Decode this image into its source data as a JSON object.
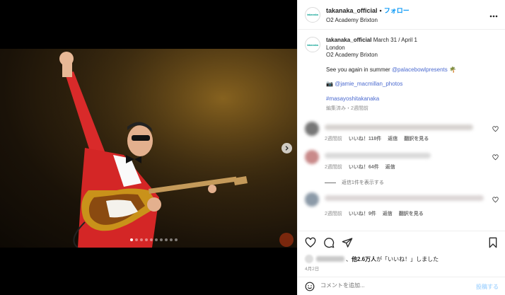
{
  "header": {
    "avatar_text": "takanaka",
    "username": "takanaka_official",
    "separator": "•",
    "follow_label": "フォロー",
    "location": "O2 Academy Brixton"
  },
  "caption": {
    "username": "takanaka_official",
    "line1": "March 31 / April 1",
    "line2": "London",
    "line3": "O2 Academy Brixton",
    "line4_text": "See you again in summer ",
    "line4_mention": "@palacebowlpresents",
    "line4_emoji": "🌴",
    "credit_emoji": "📷",
    "credit_mention": "@jamie_macmillan_photos",
    "hashtag": "#masayoshitakanaka",
    "meta": "編集済み・2週間前"
  },
  "comments": [
    {
      "time": "2週間前",
      "likes": "いいね！118件",
      "reply": "返信",
      "translate": "翻訳を見る"
    },
    {
      "time": "2週間前",
      "likes": "いいね！64件",
      "reply": "返信"
    },
    {
      "time": "2週間前",
      "likes": "いいね！9件",
      "reply": "返信",
      "translate": "翻訳を見る"
    }
  ],
  "view_replies": "返信1件を表示する",
  "likes_summary": {
    "prefix": "、",
    "count": "他2.6万人",
    "suffix": "が「いいね！」しました"
  },
  "post_date": "4月2日",
  "comment_placeholder": "コメントを追加...",
  "post_button": "投稿する",
  "carousel": {
    "slide_count": 10,
    "active_index": 0
  },
  "colors": {
    "accent": "#0095f6",
    "link": "#00376b",
    "hashtag": "#4c6bd0",
    "meta": "#8e8e8e"
  }
}
